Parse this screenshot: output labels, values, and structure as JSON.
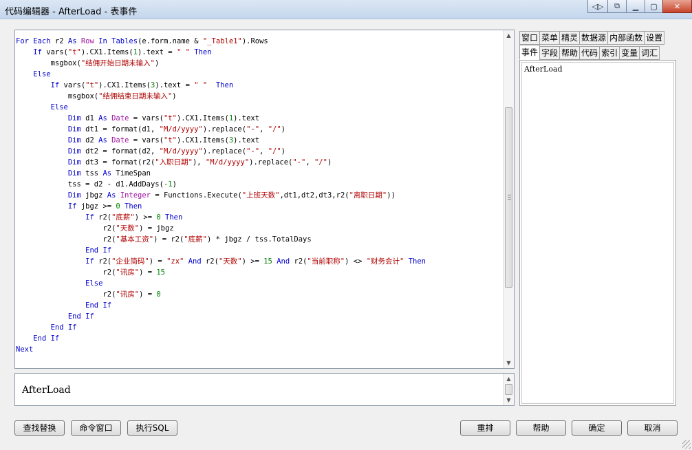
{
  "window": {
    "title": "代码编辑器 - AfterLoad - 表事件",
    "caption_buttons": [
      {
        "name": "nav-arrows-icon",
        "glyph": "◁▷"
      },
      {
        "name": "restore-icon",
        "glyph": "⧉"
      },
      {
        "name": "minimize-icon",
        "glyph": "▁"
      },
      {
        "name": "maximize-icon",
        "glyph": "▢"
      },
      {
        "name": "close-icon",
        "glyph": "✕"
      }
    ]
  },
  "code_lines": [
    [
      {
        "c": "k",
        "t": "For Each"
      },
      {
        "t": " r2 "
      },
      {
        "c": "k",
        "t": "As"
      },
      {
        "t": " "
      },
      {
        "c": "t",
        "t": "Row"
      },
      {
        "t": " "
      },
      {
        "c": "k",
        "t": "In"
      },
      {
        "t": " "
      },
      {
        "c": "k",
        "t": "Tables"
      },
      {
        "t": "(e.form.name & "
      },
      {
        "c": "s",
        "t": "\"_Table1\""
      },
      {
        "t": ").Rows"
      }
    ],
    [
      {
        "t": "    "
      },
      {
        "c": "k",
        "t": "If"
      },
      {
        "t": " vars("
      },
      {
        "c": "s",
        "t": "\"t\""
      },
      {
        "t": ").CX1.Items("
      },
      {
        "c": "n",
        "t": "1"
      },
      {
        "t": ").text = "
      },
      {
        "c": "s",
        "t": "\" \""
      },
      {
        "t": " "
      },
      {
        "c": "k",
        "t": "Then"
      }
    ],
    [
      {
        "t": "        msgbox("
      },
      {
        "c": "s",
        "t": "\"结佣开始日期未输入\""
      },
      {
        "t": ")"
      }
    ],
    [
      {
        "t": "    "
      },
      {
        "c": "k",
        "t": "Else"
      }
    ],
    [
      {
        "t": "        "
      },
      {
        "c": "k",
        "t": "If"
      },
      {
        "t": " vars("
      },
      {
        "c": "s",
        "t": "\"t\""
      },
      {
        "t": ").CX1.Items("
      },
      {
        "c": "n",
        "t": "3"
      },
      {
        "t": ").text = "
      },
      {
        "c": "s",
        "t": "\" \""
      },
      {
        "t": "  "
      },
      {
        "c": "k",
        "t": "Then"
      }
    ],
    [
      {
        "t": "            msgbox("
      },
      {
        "c": "s",
        "t": "\"结佣结束日期未输入\""
      },
      {
        "t": ")"
      }
    ],
    [
      {
        "t": "        "
      },
      {
        "c": "k",
        "t": "Else"
      }
    ],
    [
      {
        "t": "            "
      },
      {
        "c": "k",
        "t": "Dim"
      },
      {
        "t": " d1 "
      },
      {
        "c": "k",
        "t": "As"
      },
      {
        "t": " "
      },
      {
        "c": "t",
        "t": "Date"
      },
      {
        "t": " = vars("
      },
      {
        "c": "s",
        "t": "\"t\""
      },
      {
        "t": ").CX1.Items("
      },
      {
        "c": "n",
        "t": "1"
      },
      {
        "t": ").text"
      }
    ],
    [
      {
        "t": "            "
      },
      {
        "c": "k",
        "t": "Dim"
      },
      {
        "t": " dt1 = format(d1, "
      },
      {
        "c": "s",
        "t": "\"M/d/yyyy\""
      },
      {
        "t": ").replace("
      },
      {
        "c": "s",
        "t": "\"-\""
      },
      {
        "t": ", "
      },
      {
        "c": "s",
        "t": "\"/\""
      },
      {
        "t": ")"
      }
    ],
    [
      {
        "t": "            "
      },
      {
        "c": "k",
        "t": "Dim"
      },
      {
        "t": " d2 "
      },
      {
        "c": "k",
        "t": "As"
      },
      {
        "t": " "
      },
      {
        "c": "t",
        "t": "Date"
      },
      {
        "t": " = vars("
      },
      {
        "c": "s",
        "t": "\"t\""
      },
      {
        "t": ").CX1.Items("
      },
      {
        "c": "n",
        "t": "3"
      },
      {
        "t": ").text"
      }
    ],
    [
      {
        "t": "            "
      },
      {
        "c": "k",
        "t": "Dim"
      },
      {
        "t": " dt2 = format(d2, "
      },
      {
        "c": "s",
        "t": "\"M/d/yyyy\""
      },
      {
        "t": ").replace("
      },
      {
        "c": "s",
        "t": "\"-\""
      },
      {
        "t": ", "
      },
      {
        "c": "s",
        "t": "\"/\""
      },
      {
        "t": ")"
      }
    ],
    [
      {
        "t": "            "
      },
      {
        "c": "k",
        "t": "Dim"
      },
      {
        "t": " dt3 = format(r2("
      },
      {
        "c": "s",
        "t": "\"入职日期\""
      },
      {
        "t": "), "
      },
      {
        "c": "s",
        "t": "\"M/d/yyyy\""
      },
      {
        "t": ").replace("
      },
      {
        "c": "s",
        "t": "\"-\""
      },
      {
        "t": ", "
      },
      {
        "c": "s",
        "t": "\"/\""
      },
      {
        "t": ")"
      }
    ],
    [
      {
        "t": "            "
      },
      {
        "c": "k",
        "t": "Dim"
      },
      {
        "t": " tss "
      },
      {
        "c": "k",
        "t": "As"
      },
      {
        "t": " TimeSpan"
      }
    ],
    [
      {
        "t": "            tss = d2 - d1.AddDays("
      },
      {
        "c": "n",
        "t": "-1"
      },
      {
        "t": ")"
      }
    ],
    [
      {
        "t": "            "
      },
      {
        "c": "k",
        "t": "Dim"
      },
      {
        "t": " jbgz "
      },
      {
        "c": "k",
        "t": "As"
      },
      {
        "t": " "
      },
      {
        "c": "t",
        "t": "Integer"
      },
      {
        "t": " = Functions.Execute("
      },
      {
        "c": "s",
        "t": "\"上班天数\""
      },
      {
        "t": ",dt1,dt2,dt3,r2("
      },
      {
        "c": "s",
        "t": "\"离职日期\""
      },
      {
        "t": "))"
      }
    ],
    [
      {
        "t": "            "
      },
      {
        "c": "k",
        "t": "If"
      },
      {
        "t": " jbgz >= "
      },
      {
        "c": "n",
        "t": "0"
      },
      {
        "t": " "
      },
      {
        "c": "k",
        "t": "Then"
      }
    ],
    [
      {
        "t": "                "
      },
      {
        "c": "k",
        "t": "If"
      },
      {
        "t": " r2("
      },
      {
        "c": "s",
        "t": "\"底薪\""
      },
      {
        "t": ") >= "
      },
      {
        "c": "n",
        "t": "0"
      },
      {
        "t": " "
      },
      {
        "c": "k",
        "t": "Then"
      }
    ],
    [
      {
        "t": "                    r2("
      },
      {
        "c": "s",
        "t": "\"天数\""
      },
      {
        "t": ") = jbgz"
      }
    ],
    [
      {
        "t": "                    r2("
      },
      {
        "c": "s",
        "t": "\"基本工资\""
      },
      {
        "t": ") = r2("
      },
      {
        "c": "s",
        "t": "\"底薪\""
      },
      {
        "t": ") * jbgz / tss.TotalDays"
      }
    ],
    [
      {
        "t": "                "
      },
      {
        "c": "k",
        "t": "End If"
      }
    ],
    [
      {
        "t": "                "
      },
      {
        "c": "k",
        "t": "If"
      },
      {
        "t": " r2("
      },
      {
        "c": "s",
        "t": "\"企业简码\""
      },
      {
        "t": ") = "
      },
      {
        "c": "s",
        "t": "\"zx\""
      },
      {
        "t": " "
      },
      {
        "c": "k",
        "t": "And"
      },
      {
        "t": " r2("
      },
      {
        "c": "s",
        "t": "\"天数\""
      },
      {
        "t": ") >= "
      },
      {
        "c": "n",
        "t": "15"
      },
      {
        "t": " "
      },
      {
        "c": "k",
        "t": "And"
      },
      {
        "t": " r2("
      },
      {
        "c": "s",
        "t": "\"当前职称\""
      },
      {
        "t": ") <> "
      },
      {
        "c": "s",
        "t": "\"财务会计\""
      },
      {
        "t": " "
      },
      {
        "c": "k",
        "t": "Then"
      }
    ],
    [
      {
        "t": "                    r2("
      },
      {
        "c": "s",
        "t": "\"讯房\""
      },
      {
        "t": ") = "
      },
      {
        "c": "n",
        "t": "15"
      }
    ],
    [
      {
        "t": "                "
      },
      {
        "c": "k",
        "t": "Else"
      }
    ],
    [
      {
        "t": "                    r2("
      },
      {
        "c": "s",
        "t": "\"讯房\""
      },
      {
        "t": ") = "
      },
      {
        "c": "n",
        "t": "0"
      }
    ],
    [
      {
        "t": "                "
      },
      {
        "c": "k",
        "t": "End If"
      }
    ],
    [
      {
        "t": "            "
      },
      {
        "c": "k",
        "t": "End If"
      }
    ],
    [
      {
        "t": "        "
      },
      {
        "c": "k",
        "t": "End If"
      }
    ],
    [
      {
        "t": "    "
      },
      {
        "c": "k",
        "t": "End If"
      }
    ],
    [
      {
        "c": "k",
        "t": "Next"
      }
    ]
  ],
  "name_box": {
    "value": "AfterLoad"
  },
  "tabs_row1": [
    "窗口",
    "菜单",
    "精灵",
    "数据源",
    "内部函数",
    "设置"
  ],
  "tabs_row2": [
    "事件",
    "字段",
    "帮助",
    "代码",
    "索引",
    "变量",
    "词汇"
  ],
  "active_tab": "事件",
  "event_list": [
    "AfterLoad"
  ],
  "buttons": {
    "find_replace": "查找替换",
    "command_window": "命令窗口",
    "execute_sql": "执行SQL",
    "rearrange": "重排",
    "help": "帮助",
    "ok": "确定",
    "cancel": "取消"
  },
  "colors": {
    "keyword": "#0000cc",
    "type": "#a010a0",
    "string": "#b00000",
    "number": "#008000"
  }
}
